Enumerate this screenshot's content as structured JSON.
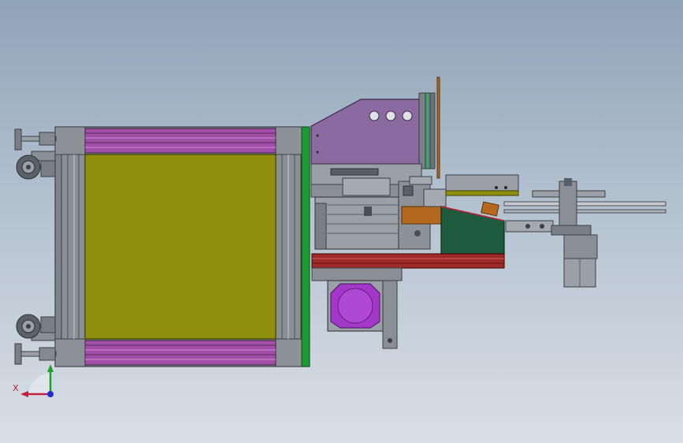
{
  "viewport": {
    "background_top": "#8fa3b8",
    "background_bottom": "#d9dfe6"
  },
  "triad": {
    "x_label": "X",
    "x_color": "#c0203a",
    "y_color": "#1fa02a",
    "z_color": "#1f2fd0"
  },
  "colors": {
    "frame_gray": "#8a8f96",
    "frame_dark": "#4a4e55",
    "rail_purple": "#a04ea6",
    "panel_olive": "#8f8f0e",
    "plate_green": "#1d9a32",
    "bracket_violet": "#8b6aa2",
    "housing_green": "#1e5a3c",
    "rail_red": "#a02a2a",
    "block_orange": "#b5691e",
    "fan_violet": "#a338c8",
    "motor_gray": "#9aa0a6"
  },
  "icons": {
    "caster_wheel": "caster-wheel-icon",
    "leveling_foot": "leveling-foot-icon",
    "coordinate_triad": "coordinate-triad-icon"
  }
}
